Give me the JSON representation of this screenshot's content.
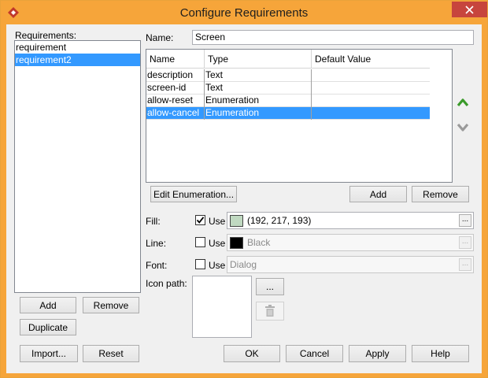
{
  "window": {
    "title": "Configure Requirements"
  },
  "icons": {
    "app": "app-logo-icon",
    "close": "close-icon",
    "move_up": "arrow-up-icon",
    "move_down": "arrow-down-icon",
    "delete": "trash-icon"
  },
  "colors": {
    "accent": "#3399ff",
    "titlebar": "#f6a53a",
    "close": "#c7453d",
    "fill_swatch": "#c0d9c1",
    "line_swatch": "#000000"
  },
  "requirements": {
    "label": "Requirements:",
    "items": [
      {
        "label": "requirement",
        "selected": false
      },
      {
        "label": "requirement2",
        "selected": true
      }
    ],
    "add_label": "Add",
    "remove_label": "Remove",
    "duplicate_label": "Duplicate"
  },
  "name_field": {
    "label": "Name:",
    "value": "Screen"
  },
  "properties": {
    "columns": [
      "Name",
      "Type",
      "Default Value"
    ],
    "rows": [
      {
        "name": "description",
        "type": "Text",
        "default": "",
        "selected": false
      },
      {
        "name": "screen-id",
        "type": "Text",
        "default": "",
        "selected": false
      },
      {
        "name": "allow-reset",
        "type": "Enumeration",
        "default": "",
        "selected": false
      },
      {
        "name": "allow-cancel",
        "type": "Enumeration",
        "default": "",
        "selected": true
      }
    ],
    "edit_enum_label": "Edit Enumeration...",
    "add_label": "Add",
    "remove_label": "Remove"
  },
  "style": {
    "fill": {
      "label": "Fill:",
      "use_label": "Use",
      "checked": true,
      "value": "(192, 217, 193)",
      "button": "..."
    },
    "line": {
      "label": "Line:",
      "use_label": "Use",
      "checked": false,
      "value": "Black",
      "button": "..."
    },
    "font": {
      "label": "Font:",
      "use_label": "Use",
      "checked": false,
      "value": "Dialog",
      "button": "..."
    },
    "icon_path": {
      "label": "Icon path:",
      "browse": "..."
    }
  },
  "footer": {
    "import_label": "Import...",
    "reset_label": "Reset",
    "ok_label": "OK",
    "cancel_label": "Cancel",
    "apply_label": "Apply",
    "help_label": "Help"
  }
}
